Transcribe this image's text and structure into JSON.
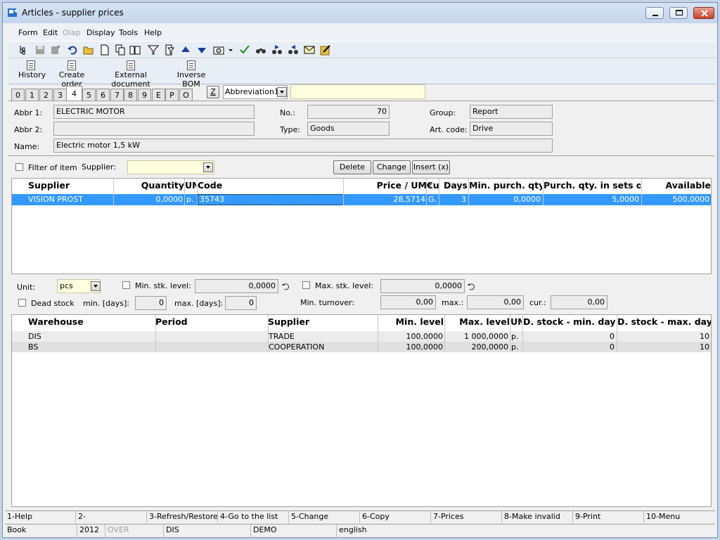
{
  "window": {
    "title": "Articles - supplier prices"
  },
  "menu": [
    {
      "label": "Form",
      "disabled": false
    },
    {
      "label": "Edit",
      "disabled": false
    },
    {
      "label": "Olap",
      "disabled": true
    },
    {
      "label": "Display",
      "disabled": false
    },
    {
      "label": "Tools",
      "disabled": false
    },
    {
      "label": "Help",
      "disabled": false
    }
  ],
  "actions": [
    "History",
    "Create order",
    "External document",
    "Inverse BOM"
  ],
  "tabs": [
    "0",
    "1",
    "2",
    "3",
    "4",
    "5",
    "6",
    "7",
    "8",
    "9",
    "E",
    "P",
    "O"
  ],
  "active_tab": "4",
  "tab_sort": {
    "z_button": "Z",
    "sort_field": "Abbreviation1",
    "search_value": ""
  },
  "header_form": {
    "abbr1_label": "Abbr 1:",
    "abbr1": "ELECTRIC MOTOR",
    "abbr2_label": "Abbr 2:",
    "abbr2": "",
    "name_label": "Name:",
    "name": "Electric motor 1,5 kW",
    "no_label": "No.:",
    "no": "70",
    "type_label": "Type:",
    "type": "Goods",
    "group_label": "Group:",
    "group": "Report",
    "artcode_label": "Art. code:",
    "artcode": "Drive"
  },
  "filter": {
    "filter_label": "Filter of item",
    "supplier_label": "Supplier:",
    "supplier_value": "",
    "delete": "Delete",
    "change": "Change",
    "insert": "Insert (x)"
  },
  "supplier_grid": {
    "headers": [
      "Supplier",
      "Quantity",
      "UM",
      "Code",
      "Price / UM",
      "€u",
      "Days",
      "Min. purch. qty.",
      "Purch. qty. in sets of",
      "Available"
    ],
    "rows": [
      [
        "VISION PROST",
        "0,0000",
        "p.",
        "35743",
        "28,5714",
        "G.",
        "3",
        "0,0000",
        "5,0000",
        "500,0000"
      ]
    ]
  },
  "stock": {
    "unit_label": "Unit:",
    "unit_value": "pcs",
    "min_stk_label": "Min. stk. level:",
    "min_stk_value": "0,0000",
    "max_stk_label": "Max. stk. level:",
    "max_stk_value": "0,0000",
    "dead_stock_label": "Dead stock",
    "min_days_label": "min. [days]:",
    "min_days_value": "0",
    "max_days_label": "max. [days]:",
    "max_days_value": "0",
    "min_turnover_label": "Min. turnover:",
    "min_turnover_value": "0,00",
    "max_label": "max.:",
    "max_value": "0,00",
    "cur_label": "cur.:",
    "cur_value": "0,00"
  },
  "warehouse_grid": {
    "headers": [
      "Warehouse",
      "Period",
      "Supplier",
      "Min. level",
      "Max. level",
      "UM",
      "D. stock - min. days",
      "D. stock - max. days"
    ],
    "rows": [
      [
        "DIS",
        "",
        "TRADE",
        "100,0000",
        "1 000,0000",
        "p.",
        "0",
        "10"
      ],
      [
        "BS",
        "",
        "COOPERATION",
        "100,0000",
        "200,0000",
        "p.",
        "0",
        "10"
      ]
    ]
  },
  "fkeys": [
    "1-Help",
    "2-",
    "3-Refresh/Restore",
    "4-Go to the list",
    "5-Change",
    "6-Copy",
    "7-Prices",
    "8-Make invalid",
    "9-Print",
    "10-Menu"
  ],
  "status": [
    "Book",
    "2012",
    "OVER",
    "DIS",
    "DEMO",
    "english"
  ],
  "colors": {
    "selection": "#3399ff",
    "selection_text": "#ffffff",
    "field_yellow": "#ffffe0"
  }
}
